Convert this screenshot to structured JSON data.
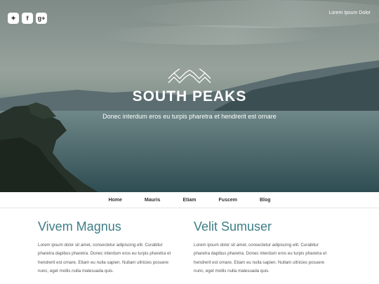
{
  "hero": {
    "top_link": "Lorem Ipsum Dolor",
    "title": "SOUTH PEAKS",
    "tagline": "Donec interdum eros eu turpis pharetra et hendrerit est ornare",
    "social": [
      {
        "icon": "twitter-icon",
        "glyph": "✦"
      },
      {
        "icon": "facebook-icon",
        "glyph": "f"
      },
      {
        "icon": "google-plus-icon",
        "glyph": "g+"
      }
    ]
  },
  "nav": {
    "items": [
      "Home",
      "Mauris",
      "Etiam",
      "Fuscem",
      "Blog"
    ]
  },
  "columns": [
    {
      "heading": "Vivem Magnus",
      "body": "Lorem ipsum dolor sit amet, consectetur adipiscing elit. Curabitur pharetra dapibus pharetra. Donec interdum eros eu turpis pharetra et hendrerit est ornare. Etiam eu nulla sapien. Nullam ultricies posuere nunc, eget mollis nulla malesuada quis."
    },
    {
      "heading": "Velit Sumuser",
      "body": "Lorem ipsum dolor sit amet, consectetur adipiscing elit. Curabitur pharetra dapibus pharetra. Donec interdum eros eu turpis pharetra et hendrerit est ornare. Etiam eu nulla sapien. Nullam ultricies posuere nunc, eget mollis nulla malesuada quis."
    }
  ],
  "colors": {
    "accent": "#3d7e85",
    "body_text": "#555555",
    "nav_text": "#333333"
  }
}
